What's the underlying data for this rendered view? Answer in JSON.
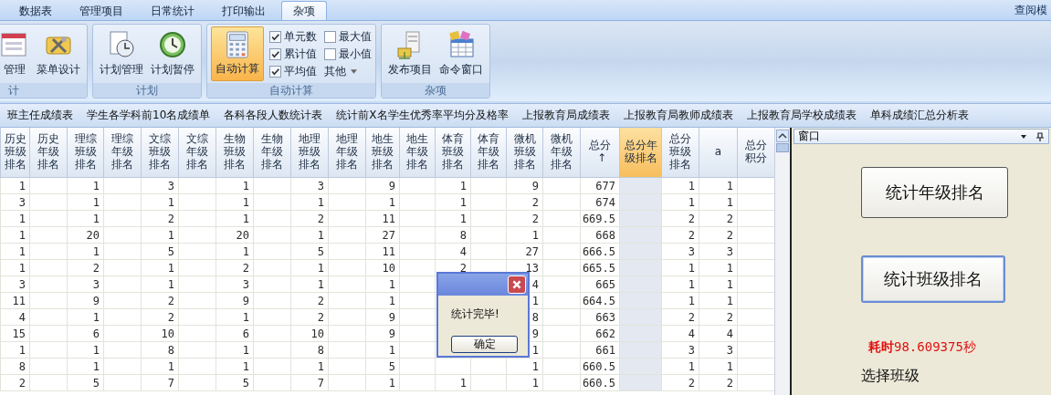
{
  "ribbon_tabs": [
    {
      "label": "数据表",
      "selected": false
    },
    {
      "label": "管理项目",
      "selected": false
    },
    {
      "label": "日常统计",
      "selected": false
    },
    {
      "label": "打印输出",
      "selected": false
    },
    {
      "label": "杂项",
      "selected": true
    }
  ],
  "ribbon_side_label": "查阅模",
  "ribbon_groups": [
    {
      "kind": "buttons",
      "label": "计",
      "buttons": [
        {
          "label": "管理",
          "kind": "form"
        },
        {
          "label": "菜单设计",
          "kind": "tools"
        }
      ]
    },
    {
      "kind": "buttons",
      "label": "计划",
      "buttons": [
        {
          "label": "计划管理",
          "kind": "doc-clock"
        },
        {
          "label": "计划暂停",
          "kind": "clock"
        }
      ]
    },
    {
      "kind": "calc",
      "label": "自动计算",
      "button": {
        "label": "自动计算",
        "selected": true
      },
      "options": [
        {
          "kind": "check",
          "label": "单元数",
          "checked": true
        },
        {
          "kind": "check",
          "label": "最大值",
          "checked": false
        },
        {
          "kind": "check",
          "label": "累计值",
          "checked": true
        },
        {
          "kind": "check",
          "label": "最小值",
          "checked": false
        },
        {
          "kind": "check",
          "label": "平均值",
          "checked": true
        },
        {
          "kind": "menu",
          "label": "其他"
        }
      ]
    },
    {
      "kind": "buttons",
      "label": "杂项",
      "buttons": [
        {
          "label": "发布项目",
          "kind": "files"
        },
        {
          "label": "命令窗口",
          "kind": "window"
        }
      ]
    }
  ],
  "report_tabs": [
    "班主任成绩表",
    "学生各学科前10名成绩单",
    "各科各段人数统计表",
    "统计前X名学生优秀率平均分及格率",
    "上报教育局成绩表",
    "上报教育局教师成绩表",
    "上报教育局学校成绩表",
    "单科成绩汇总分析表"
  ],
  "table": {
    "columns": [
      {
        "label": "历史班级排名",
        "selected": false
      },
      {
        "label": "历史年级排名",
        "selected": false
      },
      {
        "label": "理综班级排名",
        "selected": false
      },
      {
        "label": "理综年级排名",
        "selected": false
      },
      {
        "label": "文综班级排名",
        "selected": false
      },
      {
        "label": "文综年级排名",
        "selected": false
      },
      {
        "label": "生物班级排名",
        "selected": false
      },
      {
        "label": "生物年级排名",
        "selected": false
      },
      {
        "label": "地理班级排名",
        "selected": false
      },
      {
        "label": "地理年级排名",
        "selected": false
      },
      {
        "label": "地生班级排名",
        "selected": false
      },
      {
        "label": "地生年级排名",
        "selected": false
      },
      {
        "label": "体育班级排名",
        "selected": false
      },
      {
        "label": "体育年级排名",
        "selected": false
      },
      {
        "label": "微机班级排名",
        "selected": false
      },
      {
        "label": "微机年级排名",
        "selected": false
      },
      {
        "label": "总分",
        "sort_arrow": "↑",
        "selected": false
      },
      {
        "label": "总分年级排名",
        "selected": true
      },
      {
        "label": "总分班级排名",
        "selected": false
      },
      {
        "label": "a",
        "selected": false
      },
      {
        "label": "总分积分",
        "selected": false
      }
    ],
    "rows": [
      [
        "1",
        null,
        "1",
        null,
        "3",
        null,
        "1",
        null,
        "3",
        null,
        "9",
        null,
        "1",
        null,
        "9",
        null,
        "677",
        null,
        "1",
        "1",
        null
      ],
      [
        "3",
        null,
        "1",
        null,
        "1",
        null,
        "1",
        null,
        "1",
        null,
        "1",
        null,
        "1",
        null,
        "2",
        null,
        "674",
        null,
        "1",
        "1",
        null
      ],
      [
        "1",
        null,
        "1",
        null,
        "2",
        null,
        "1",
        null,
        "2",
        null,
        "11",
        null,
        "1",
        null,
        "2",
        null,
        "669.5",
        null,
        "2",
        "2",
        null
      ],
      [
        "1",
        null,
        "20",
        null,
        "1",
        null,
        "20",
        null,
        "1",
        null,
        "27",
        null,
        "8",
        null,
        "1",
        null,
        "668",
        null,
        "2",
        "2",
        null
      ],
      [
        "1",
        null,
        "1",
        null,
        "5",
        null,
        "1",
        null,
        "5",
        null,
        "11",
        null,
        "4",
        null,
        "27",
        null,
        "666.5",
        null,
        "3",
        "3",
        null
      ],
      [
        "1",
        null,
        "2",
        null,
        "1",
        null,
        "2",
        null,
        "1",
        null,
        "10",
        null,
        "2",
        null,
        "13",
        null,
        "665.5",
        null,
        "1",
        "1",
        null
      ],
      [
        "3",
        null,
        "3",
        null,
        "1",
        null,
        "3",
        null,
        "1",
        null,
        "1",
        null,
        null,
        null,
        "4",
        null,
        "665",
        null,
        "1",
        "1",
        null
      ],
      [
        "11",
        null,
        "9",
        null,
        "2",
        null,
        "9",
        null,
        "2",
        null,
        "1",
        null,
        null,
        null,
        "1",
        null,
        "664.5",
        null,
        "1",
        "1",
        null
      ],
      [
        "4",
        null,
        "1",
        null,
        "2",
        null,
        "1",
        null,
        "2",
        null,
        "9",
        null,
        null,
        null,
        "8",
        null,
        "663",
        null,
        "2",
        "2",
        null
      ],
      [
        "15",
        null,
        "6",
        null,
        "10",
        null,
        "6",
        null,
        "10",
        null,
        "9",
        null,
        null,
        null,
        "9",
        null,
        "662",
        null,
        "4",
        "4",
        null
      ],
      [
        "1",
        null,
        "1",
        null,
        "8",
        null,
        "1",
        null,
        "8",
        null,
        "1",
        null,
        null,
        null,
        "1",
        null,
        "661",
        null,
        "3",
        "3",
        null
      ],
      [
        "8",
        null,
        "1",
        null,
        "1",
        null,
        "1",
        null,
        "1",
        null,
        "5",
        null,
        null,
        null,
        "1",
        null,
        "660.5",
        null,
        "1",
        "1",
        null
      ],
      [
        "2",
        null,
        "5",
        null,
        "7",
        null,
        "5",
        null,
        "7",
        null,
        "1",
        null,
        "1",
        null,
        "1",
        null,
        "660.5",
        null,
        "2",
        "2",
        null
      ]
    ]
  },
  "dialog": {
    "message": "统计完毕!",
    "button": "确定"
  },
  "panel": {
    "title": "窗口",
    "buttons": [
      {
        "label": "统计年级排名",
        "focused": false
      },
      {
        "label": "统计班级排名",
        "focused": true
      }
    ],
    "timing": "**耗时**98.609375秒",
    "section_label": "选择班级"
  }
}
